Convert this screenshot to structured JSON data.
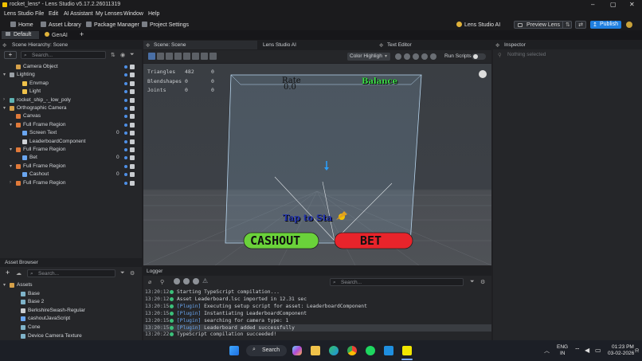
{
  "window": {
    "title": "rocket_lens* - Lens Studio v5.17.2.26011319"
  },
  "menu": [
    "Lens Studio",
    "File",
    "Edit",
    "AI Assistant",
    "My Lenses",
    "Window",
    "Help"
  ],
  "toolbar": {
    "home": "Home",
    "asset_library": "Asset Library",
    "package_manager": "Package Manager",
    "project_settings": "Project Settings",
    "lens_studio_ai": "Lens Studio AI",
    "preview_lens": "Preview Lens",
    "publish": "Publish"
  },
  "workspace_tabs": [
    "Default",
    "GenAI"
  ],
  "hierarchy": {
    "title": "Scene Hierarchy: Scene",
    "search_placeholder": "Search...",
    "items": [
      {
        "label": "Camera Object",
        "depth": 1,
        "icon": "camera-icon",
        "color": "#d6a14a",
        "arrow": ""
      },
      {
        "label": "Lighting",
        "depth": 0,
        "icon": "folder-icon",
        "color": "#9aa0a6",
        "arrow": "▾"
      },
      {
        "label": "Envmap",
        "depth": 2,
        "icon": "light-icon",
        "color": "#f0c24a",
        "arrow": ""
      },
      {
        "label": "Light",
        "depth": 2,
        "icon": "light-icon",
        "color": "#f0c24a",
        "arrow": ""
      },
      {
        "label": "rocket_ship_-_low_poly",
        "depth": 0,
        "icon": "mesh-icon",
        "color": "#5fb3b3",
        "arrow": "›"
      },
      {
        "label": "Orthographic Camera",
        "depth": 0,
        "icon": "camera-icon",
        "color": "#d6a14a",
        "arrow": "▾"
      },
      {
        "label": "Canvas",
        "depth": 1,
        "icon": "canvas-icon",
        "color": "#e07a3a",
        "arrow": ""
      },
      {
        "label": "Full Frame Region",
        "depth": 1,
        "icon": "region-icon",
        "color": "#e07a3a",
        "arrow": "▾"
      },
      {
        "label": "Screen Text",
        "depth": 2,
        "icon": "text-icon",
        "color": "#6aa6f0",
        "arrow": "",
        "num": "0"
      },
      {
        "label": "LeaderboardComponent",
        "depth": 2,
        "icon": "component-icon",
        "color": "#d0d3d7",
        "arrow": ""
      },
      {
        "label": "Full Frame Region",
        "depth": 1,
        "icon": "region-icon",
        "color": "#e07a3a",
        "arrow": "▾"
      },
      {
        "label": "Bet",
        "depth": 2,
        "icon": "text-icon",
        "color": "#6aa6f0",
        "arrow": "",
        "num": "0"
      },
      {
        "label": "Full Frame Region",
        "depth": 1,
        "icon": "region-icon",
        "color": "#e07a3a",
        "arrow": "▾"
      },
      {
        "label": "Cashout",
        "depth": 2,
        "icon": "text-icon",
        "color": "#6aa6f0",
        "arrow": "",
        "num": "0"
      },
      {
        "label": "Full Frame Region",
        "depth": 1,
        "icon": "region-icon",
        "color": "#e07a3a",
        "arrow": "›"
      }
    ]
  },
  "asset_browser": {
    "title": "Asset Browser",
    "search_placeholder": "Search...",
    "items": [
      "Assets",
      "Base",
      "Base 2",
      "BerkshireSwash-Regular",
      "cashoutJavaScript",
      "Cone",
      "Device Camera Texture"
    ]
  },
  "scene": {
    "tabs": [
      "Scene: Scene",
      "Lens Studio AI",
      "Text Editor"
    ],
    "color_mode": "Color Highligh",
    "run_scripts": "Run Scripts",
    "stats": [
      {
        "name": "Triangles",
        "a": "482",
        "b": "0"
      },
      {
        "name": "Blendshapes",
        "a": "0",
        "b": "0"
      },
      {
        "name": "Joints",
        "a": "0",
        "b": "0"
      }
    ],
    "rate_label": "Rate",
    "rate_value": "0.0",
    "balance_label": "Balance",
    "tap_to_start": "Tap to Sta",
    "cashout": "CASHOUT",
    "bet": "BET",
    "colors": {
      "cashout": "#6ad23a",
      "bet": "#e8242b",
      "balance": "#3fe04a"
    }
  },
  "inspector": {
    "title": "Inspector",
    "empty": "Nothing selected"
  },
  "logger": {
    "title": "Logger",
    "search_placeholder": "Search...",
    "lines": [
      {
        "time": "13:20:12",
        "prefix": "",
        "msg": "Starting TypeScript compilation..."
      },
      {
        "time": "13:20:12",
        "prefix": "",
        "msg": "Asset Leaderboard.lsc imported in 12.31 sec"
      },
      {
        "time": "13:20:15",
        "prefix": "[Plugin]",
        "msg": "Executing setup script for asset: LeaderboardComponent"
      },
      {
        "time": "13:20:15",
        "prefix": "[Plugin]",
        "msg": "Instantiating LeaderboardComponent"
      },
      {
        "time": "13:20:15",
        "prefix": "[Plugin]",
        "msg": "searching for camera type: 1"
      },
      {
        "time": "13:20:15",
        "prefix": "[Plugin]",
        "msg": "Leaderboard added successfully"
      },
      {
        "time": "13:20:22",
        "prefix": "",
        "msg": "TypeScript compilation succeeded!"
      }
    ]
  },
  "taskbar": {
    "search": "Search",
    "lang": "ENG",
    "lang2": "IN",
    "time": "01:23 PM",
    "date": "03-02-2026"
  }
}
